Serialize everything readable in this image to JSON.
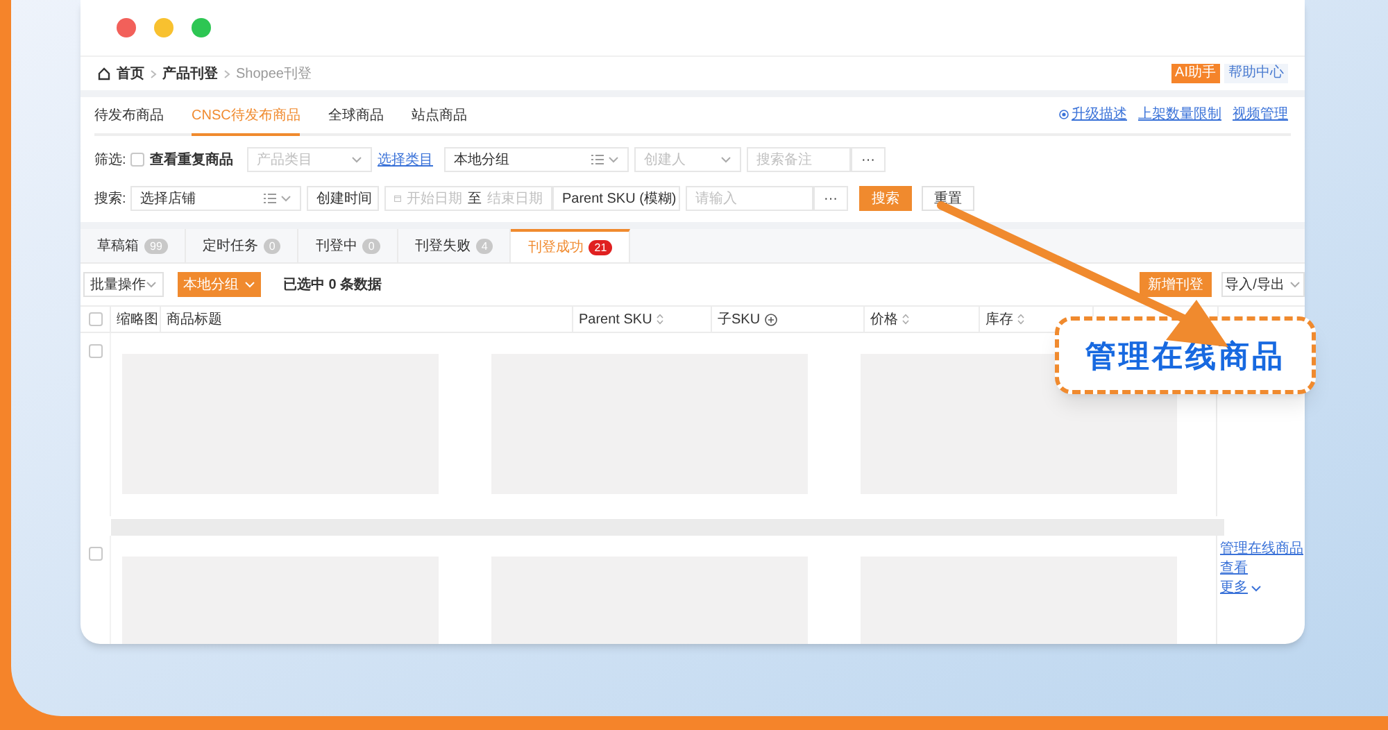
{
  "breadcrumb": [
    {
      "label": "首页",
      "current": false
    },
    {
      "label": "产品刊登",
      "current": false
    },
    {
      "label": "Shopee刊登",
      "current": true
    }
  ],
  "header_buttons": [
    {
      "label": "AI助手",
      "kind": "primary"
    },
    {
      "label": "帮助中心",
      "kind": "plain"
    }
  ],
  "tabs": [
    {
      "label": "待发布商品",
      "selected": false
    },
    {
      "label": "CNSC待发布商品",
      "selected": true
    },
    {
      "label": "全球商品",
      "selected": false
    },
    {
      "label": "站点商品",
      "selected": false
    }
  ],
  "links": [
    {
      "label": "升级描述",
      "kind": "icon"
    },
    {
      "label": "上架数量限制",
      "kind": "plain"
    },
    {
      "label": "视频管理",
      "kind": "plain"
    }
  ],
  "filter_row": [
    {
      "kind": "label",
      "text": "筛选:"
    },
    {
      "kind": "checkbox",
      "label": "查看重复商品",
      "checked": false
    },
    {
      "kind": "select",
      "placeholder": "产品类目"
    },
    {
      "kind": "link",
      "text": "选择类目"
    },
    {
      "kind": "picker",
      "value": "本地分组"
    },
    {
      "kind": "select",
      "placeholder": "创建人"
    },
    {
      "kind": "input",
      "placeholder": "搜索备注"
    },
    {
      "kind": "more",
      "text": "···"
    }
  ],
  "search_row": [
    {
      "kind": "label",
      "text": "搜索:"
    },
    {
      "kind": "picker",
      "value": "选择店铺"
    },
    {
      "kind": "select",
      "value": "创建时间"
    },
    {
      "kind": "daterange",
      "start": "开始日期",
      "separator": "至",
      "end": "结束日期"
    },
    {
      "kind": "select",
      "value": "Parent SKU (模糊)"
    },
    {
      "kind": "input",
      "placeholder": "请输入"
    },
    {
      "kind": "more",
      "text": "···"
    },
    {
      "kind": "primary",
      "text": "搜索"
    },
    {
      "kind": "default",
      "text": "重置"
    }
  ],
  "status_tabs": [
    {
      "label": "草稿箱",
      "count": "99",
      "selected": false
    },
    {
      "label": "定时任务",
      "count": "0",
      "selected": false
    },
    {
      "label": "刊登中",
      "count": "0",
      "selected": false
    },
    {
      "label": "刊登失败",
      "count": "4",
      "selected": false
    },
    {
      "label": "刊登成功",
      "count": "21",
      "selected": true
    }
  ],
  "toolbar": {
    "batch": "批量操作",
    "group": "本地分组",
    "selection": "已选中 **0** 条数据",
    "add": "新增刊登",
    "import_export": "导入/导出"
  },
  "table": {
    "columns": [
      {
        "label": "缩略图",
        "kind": "plain"
      },
      {
        "label": "商品标题",
        "kind": "plain"
      },
      {
        "label": "Parent SKU",
        "kind": "sortable"
      },
      {
        "label": "子SKU",
        "kind": "add"
      },
      {
        "label": "价格",
        "kind": "sortable"
      },
      {
        "label": "库存",
        "kind": "sortable"
      }
    ],
    "header_checked": false,
    "rows": [
      {
        "checked": false
      },
      {
        "checked": false,
        "actions": [
          "管理在线商品",
          "查看",
          "更多"
        ]
      }
    ]
  },
  "callout": "管理在线商品"
}
